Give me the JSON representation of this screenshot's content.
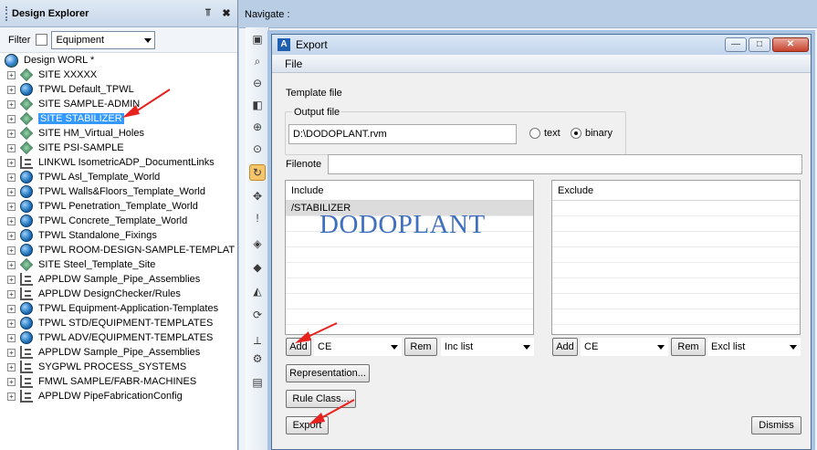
{
  "explorer": {
    "title": "Design Explorer",
    "pin_glyph": "⫪",
    "close_glyph": "✖",
    "filter_label": "Filter",
    "filter_value": "Equipment",
    "root": "Design WORL *",
    "items": [
      {
        "label": "SITE XXXXX",
        "icon": "site-icon"
      },
      {
        "label": "TPWL Default_TPWL",
        "icon": "world-icon"
      },
      {
        "label": "SITE SAMPLE-ADMIN",
        "icon": "site-icon"
      },
      {
        "label": "SITE STABILIZER",
        "icon": "site-icon",
        "selected": true
      },
      {
        "label": "SITE HM_Virtual_Holes",
        "icon": "site-icon"
      },
      {
        "label": "SITE PSI-SAMPLE",
        "icon": "site-icon"
      },
      {
        "label": "LINKWL IsometricADP_DocumentLinks",
        "icon": "link-icon"
      },
      {
        "label": "TPWL Asl_Template_World",
        "icon": "world-icon"
      },
      {
        "label": "TPWL Walls&Floors_Template_World",
        "icon": "world-icon"
      },
      {
        "label": "TPWL Penetration_Template_World",
        "icon": "world-icon"
      },
      {
        "label": "TPWL Concrete_Template_World",
        "icon": "world-icon"
      },
      {
        "label": "TPWL Standalone_Fixings",
        "icon": "world-icon"
      },
      {
        "label": "TPWL ROOM-DESIGN-SAMPLE-TEMPLAT",
        "icon": "world-icon"
      },
      {
        "label": "SITE Steel_Template_Site",
        "icon": "site-icon"
      },
      {
        "label": "APPLDW Sample_Pipe_Assemblies",
        "icon": "link-icon"
      },
      {
        "label": "APPLDW DesignChecker/Rules",
        "icon": "link-icon"
      },
      {
        "label": "TPWL Equipment-Application-Templates",
        "icon": "world-icon"
      },
      {
        "label": "TPWL STD/EQUIPMENT-TEMPLATES",
        "icon": "world-icon"
      },
      {
        "label": "TPWL ADV/EQUIPMENT-TEMPLATES",
        "icon": "world-icon"
      },
      {
        "label": "APPLDW Sample_Pipe_Assemblies",
        "icon": "link-icon"
      },
      {
        "label": "SYGPWL PROCESS_SYSTEMS",
        "icon": "link-icon"
      },
      {
        "label": "FMWL SAMPLE/FABR-MACHINES",
        "icon": "link-icon"
      },
      {
        "label": "APPLDW PipeFabricationConfig",
        "icon": "link-icon"
      }
    ]
  },
  "navigate": {
    "label": "Navigate :"
  },
  "dialog": {
    "title": "Export",
    "menu_file": "File",
    "template_file": "Template file",
    "output_file_label": "Output file",
    "output_file_value": "D:\\DODOPLANT.rvm",
    "format_text": "text",
    "format_binary": "binary",
    "filenote_label": "Filenote",
    "filenote_value": "",
    "include_header": "Include",
    "include_items": [
      "/STABILIZER"
    ],
    "exclude_header": "Exclude",
    "add_label": "Add",
    "ce_value": "CE",
    "rem_label": "Rem",
    "inc_list": "Inc list",
    "add2_label": "Add",
    "ce2_value": "CE",
    "rem2_label": "Rem",
    "excl_list": "Excl list",
    "representation": "Representation...",
    "rule_class": "Rule Class...",
    "export": "Export",
    "dismiss": "Dismiss"
  },
  "watermark": "DODOPLANT",
  "colors": {
    "selection": "#3399ff",
    "arrow": "#e8231f",
    "watermark": "#3f6fbf"
  }
}
